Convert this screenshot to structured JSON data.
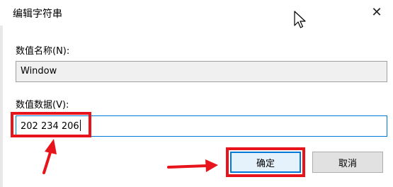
{
  "window": {
    "title": "编辑字符串",
    "close_glyph": "✕"
  },
  "value_name": {
    "label": "数值名称(N):",
    "value": "Window"
  },
  "value_data": {
    "label": "数值数据(V):",
    "value": "202 234 206"
  },
  "buttons": {
    "ok_label": "确定",
    "cancel_label": "取消"
  },
  "colors": {
    "highlight_red": "#e8141c",
    "focus_blue": "#0078d7"
  }
}
